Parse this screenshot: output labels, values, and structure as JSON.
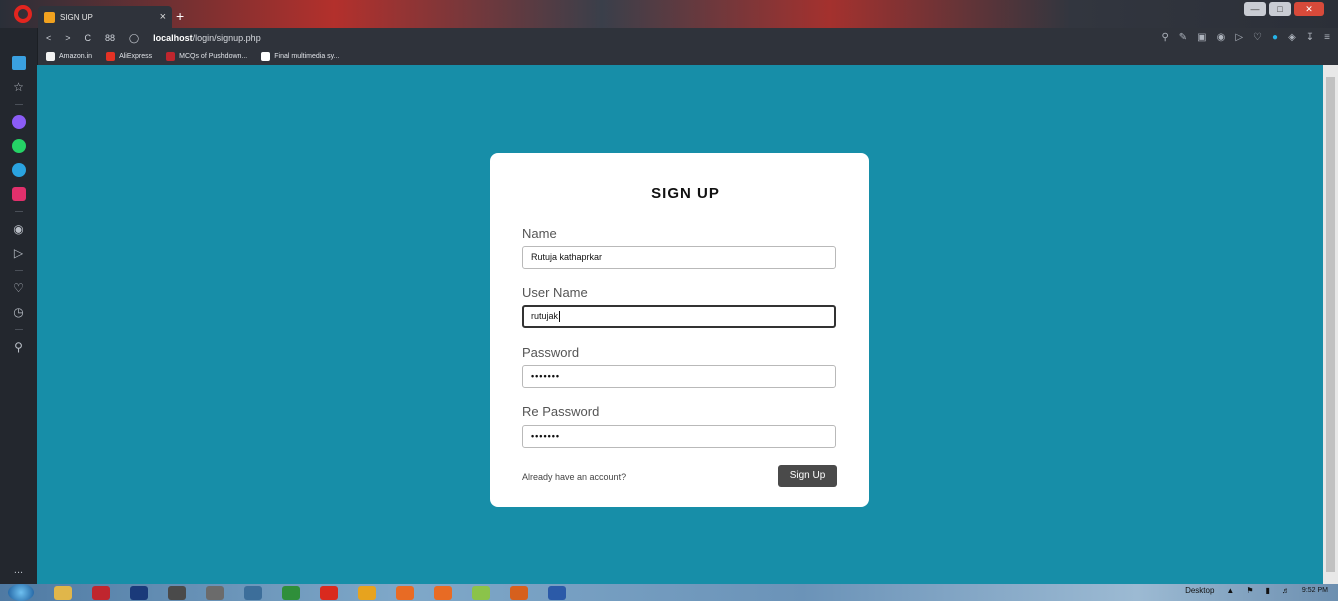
{
  "browser": {
    "tab": {
      "title": "SIGN UP",
      "close": "×"
    },
    "new_tab": "+",
    "url_host": "localhost",
    "url_path": "/login/signup.php",
    "nav": {
      "back": "<",
      "forward": ">",
      "reload": "C",
      "speed_dial": "88"
    },
    "bookmarks": [
      {
        "label": "Amazon.in",
        "color": "#2a2a2a"
      },
      {
        "label": "AliExpress",
        "color": "#e43225"
      },
      {
        "label": "MCQs of Pushdown...",
        "color": "#c0262e"
      },
      {
        "label": "Final multimedia sy...",
        "color": "#ffffff"
      }
    ],
    "addr_icons": [
      "search-icon",
      "snapshot-icon",
      "camera-icon",
      "record-icon",
      "send-icon",
      "heart-icon",
      "vpn-icon",
      "extension-icon",
      "download-icon",
      "menu-icon"
    ]
  },
  "sidebar": {
    "icons": [
      "home-icon",
      "star-icon",
      "messenger-icon",
      "whatsapp-icon",
      "telegram-icon",
      "instagram-icon",
      "player-icon",
      "flow-icon",
      "heart-icon",
      "history-icon",
      "pin-icon"
    ],
    "more": "..."
  },
  "form": {
    "title": "SIGN UP",
    "fields": [
      {
        "label": "Name",
        "value": "Rutuja kathaprkar"
      },
      {
        "label": "User Name",
        "value": "rutujak"
      },
      {
        "label": "Password",
        "value": "•••••••"
      },
      {
        "label": "Re Password",
        "value": "•••••••"
      }
    ],
    "already_text": "Already have an account?",
    "submit_label": "Sign Up"
  },
  "taskbar": {
    "desktop_label": "Desktop",
    "time": "9:52 PM",
    "apps": [
      "#1e5aa8",
      "#e0b64a",
      "#c0262e",
      "#1a3a7a",
      "#6b6b6b",
      "#3c6e9a",
      "#2f8f3a",
      "#d92a1e",
      "#e7a31e",
      "#e86b24",
      "#e86b24",
      "#8bc34a",
      "#d6601d",
      "#2b5aa8"
    ]
  },
  "colors": {
    "page_bg": "#178ea8",
    "card_bg": "#ffffff",
    "button_bg": "#4a4a4a"
  }
}
